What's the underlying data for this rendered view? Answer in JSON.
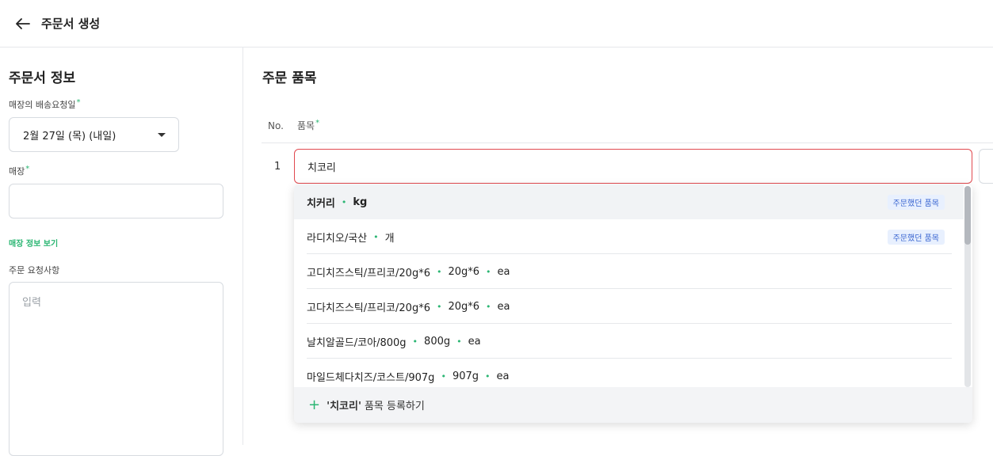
{
  "header": {
    "title": "주문서 생성",
    "back_icon": "arrow-left-icon"
  },
  "order_info": {
    "title": "주문서 정보",
    "delivery_date_label": "매장의 배송요청일",
    "delivery_date_value": "2월 27일 (목) (내일)",
    "store_label": "매장",
    "store_value": "",
    "store_info_link": "매장 정보 보기",
    "request_label": "주문 요청사항",
    "request_placeholder": "입력"
  },
  "order_items": {
    "title": "주문 품목",
    "col_no": "No.",
    "col_item": "품목",
    "row_no": "1",
    "input_value": "치코리"
  },
  "suggestions": [
    {
      "name": "치커리",
      "spec": "",
      "unit": "kg",
      "badge": "주문했던 품목",
      "active": true
    },
    {
      "name": "라디치오/국산",
      "spec": "",
      "unit": "개",
      "badge": "주문했던 품목",
      "active": false
    },
    {
      "name": "고디치즈스틱/프리코/20g*6",
      "spec": "20g*6",
      "unit": "ea",
      "badge": "",
      "active": false
    },
    {
      "name": "고다치즈스틱/프리코/20g*6",
      "spec": "20g*6",
      "unit": "ea",
      "badge": "",
      "active": false
    },
    {
      "name": "날치알골드/코아/800g",
      "spec": "800g",
      "unit": "ea",
      "badge": "",
      "active": false
    },
    {
      "name": "마일드체다치즈/코스트/907g",
      "spec": "907g",
      "unit": "ea",
      "badge": "",
      "active": false
    }
  ],
  "register": {
    "quoted": "'치코리'",
    "text": "품목 등록하기",
    "icon": "plus-icon"
  },
  "colors": {
    "accent_green": "#2bb673",
    "error_red": "#e1494f",
    "badge_blue": "#3a66d1"
  }
}
